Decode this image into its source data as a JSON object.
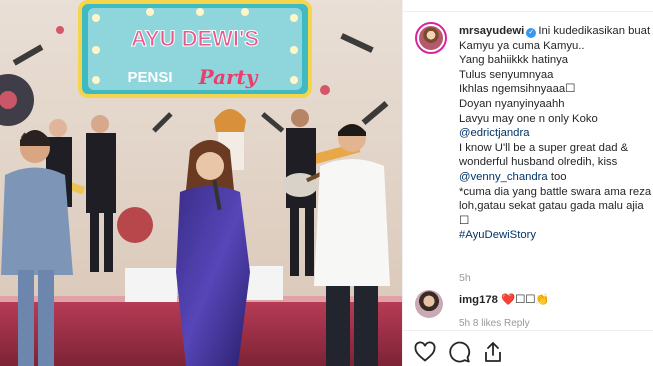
{
  "photo": {
    "banner_title": "AYU DEWI'S",
    "banner_sub_a": "PENSI",
    "banner_sub_b": "Party"
  },
  "post": {
    "username": "mrsayudewi",
    "caption_first": "Ini kudedikasikan buat",
    "caption_lines": [
      {
        "text": "Kamyu ya cuma Kamyu..",
        "type": "text"
      },
      {
        "text": "Yang bahiikkk hatinya",
        "type": "text"
      },
      {
        "text": "Tulus senyumnyaa",
        "type": "text"
      },
      {
        "text": "Ikhlas ngemsihnyaaa☐",
        "type": "text"
      },
      {
        "text": "Doyan nyanyinyaahh",
        "type": "text"
      },
      {
        "text": "Lavyu may one n only Koko",
        "type": "text"
      },
      {
        "text": "@edrictjandra",
        "type": "mention"
      },
      {
        "text": "I know U'll be a super great dad &",
        "type": "text"
      },
      {
        "text": "wonderful husband olredih, kiss",
        "type": "text"
      },
      {
        "text": "@venny_chandra",
        "suffix": " too",
        "type": "mention"
      },
      {
        "text": "*cuma dia yang battle swara ama reza",
        "type": "text"
      },
      {
        "text": "loh,gatau sekat gatau gada malu ajia",
        "type": "text"
      },
      {
        "text": "☐",
        "type": "text"
      },
      {
        "text": "#AyuDewiStory",
        "type": "hashtag"
      }
    ],
    "time": "5h"
  },
  "comment": {
    "username": "img178",
    "text": "❤️☐☐👏",
    "meta": "5h  8 likes  Reply"
  },
  "actions": {
    "like_icon": "heart-icon",
    "comment_icon": "comment-bubble-icon",
    "share_icon": "share-icon"
  },
  "colors": {
    "link": "#003569",
    "muted": "#999999",
    "verified": "#3897f0"
  }
}
